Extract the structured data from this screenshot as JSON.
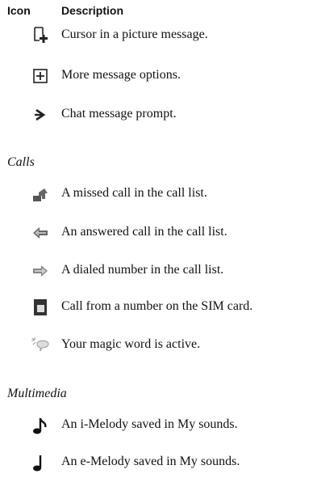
{
  "table_header": {
    "icon_label": "Icon",
    "description_label": "Description"
  },
  "message_rows": [
    {
      "icon": "picture-cursor-icon",
      "text": "Cursor in a picture message."
    },
    {
      "icon": "plus-box-icon",
      "text": "More message options."
    },
    {
      "icon": "chat-prompt-arrow-icon",
      "text": "Chat message prompt."
    }
  ],
  "calls": {
    "title": "Calls",
    "rows": [
      {
        "icon": "missed-call-icon",
        "text": "A missed call in the call list."
      },
      {
        "icon": "answered-call-icon",
        "text": "An answered call in the call list."
      },
      {
        "icon": "dialed-call-icon",
        "text": "A dialed number in the call list."
      },
      {
        "icon": "sim-card-icon",
        "text": "Call from a number on the SIM card."
      },
      {
        "icon": "magic-word-icon",
        "text": "Your magic word is active."
      }
    ]
  },
  "multimedia": {
    "title": "Multimedia",
    "rows": [
      {
        "icon": "i-melody-note-icon",
        "text": "An i-Melody saved in My sounds."
      },
      {
        "icon": "e-melody-note-icon",
        "text": "An e-Melody saved in My sounds."
      }
    ]
  }
}
